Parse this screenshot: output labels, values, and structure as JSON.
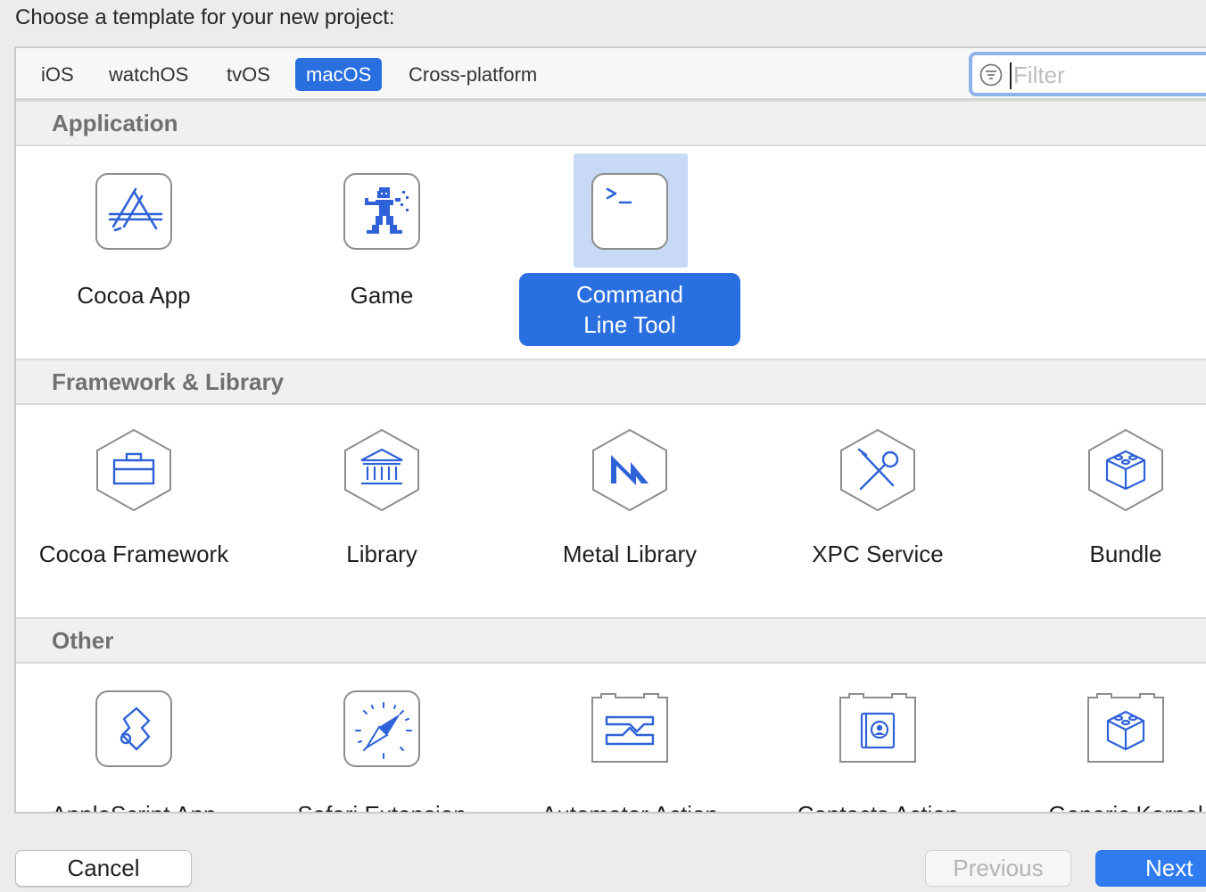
{
  "dialog": {
    "heading": "Choose a template for your new project:"
  },
  "tabs": [
    {
      "label": "iOS"
    },
    {
      "label": "watchOS"
    },
    {
      "label": "tvOS"
    },
    {
      "label": "macOS",
      "selected": true
    },
    {
      "label": "Cross-platform"
    }
  ],
  "filter": {
    "placeholder": "Filter",
    "value": "",
    "icon": "filter-icon"
  },
  "sections": [
    {
      "title": "Application",
      "items": [
        {
          "label": "Cocoa App",
          "icon": "app-store-icon"
        },
        {
          "label": "Game",
          "icon": "game-icon"
        },
        {
          "label": "Command Line Tool",
          "line1": "Command",
          "line2": "Line Tool",
          "icon": "terminal-icon",
          "selected": true
        }
      ]
    },
    {
      "title": "Framework & Library",
      "items": [
        {
          "label": "Cocoa Framework",
          "icon": "toolbox-icon"
        },
        {
          "label": "Library",
          "icon": "building-icon"
        },
        {
          "label": "Metal Library",
          "icon": "metal-icon"
        },
        {
          "label": "XPC Service",
          "icon": "tools-icon"
        },
        {
          "label": "Bundle",
          "icon": "cube-icon"
        }
      ]
    },
    {
      "title": "Other",
      "items": [
        {
          "label": "AppleScript App",
          "icon": "script-icon"
        },
        {
          "label": "Safari Extension",
          "icon": "compass-icon"
        },
        {
          "label": "Automator Action",
          "icon": "automator-icon"
        },
        {
          "label": "Contacts Action",
          "icon": "contacts-icon"
        },
        {
          "label": "Generic Kernel Extension",
          "icon": "kernel-cube-icon"
        }
      ]
    }
  ],
  "buttons": {
    "cancel": "Cancel",
    "previous": "Previous",
    "next": "Next"
  },
  "colors": {
    "accent": "#2a6fe0",
    "selection_bg": "#c8d9f6",
    "icon_blue": "#2f62d8"
  }
}
